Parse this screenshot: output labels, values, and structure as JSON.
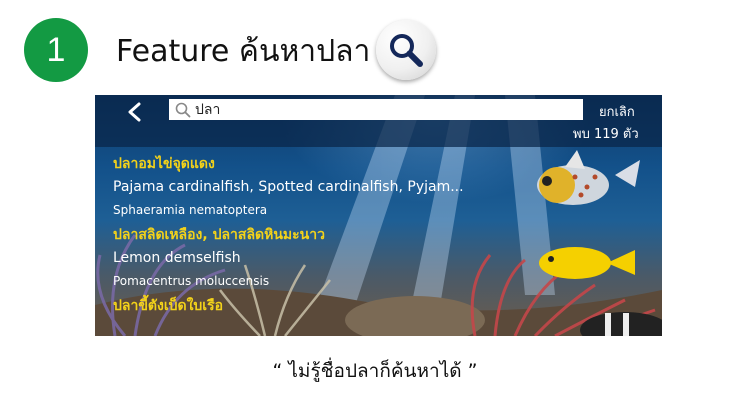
{
  "header": {
    "step_number": "1",
    "title": "Feature ค้นหาปลา"
  },
  "app": {
    "search": {
      "value": "ปลา",
      "placeholder": ""
    },
    "cancel_label": "ยกเลิก",
    "result_count": "พบ 119 ตัว",
    "results": [
      {
        "thai_name": "ปลาอมไข่จุดแดง",
        "common_name": "Pajama cardinalfish, Spotted cardinalfish, Pyjam...",
        "scientific_name": "Sphaeramia nematoptera"
      },
      {
        "thai_name": "ปลาสลิดเหลือง, ปลาสลิดหินมะนาว",
        "common_name": "Lemon demselfish",
        "scientific_name": "Pomacentrus moluccensis"
      },
      {
        "thai_name": "ปลาขี้ตังเบ็ดใบเรือ",
        "common_name": "",
        "scientific_name": ""
      }
    ]
  },
  "caption": "“ ไม่รู้ชื่อปลาก็ค้นหาได้ ”",
  "colors": {
    "badge_green": "#139a43",
    "thai_name_yellow": "#f3d21a",
    "topbar_navy": "#0a2648"
  },
  "icons": [
    "search-icon",
    "back-chevron-icon"
  ]
}
